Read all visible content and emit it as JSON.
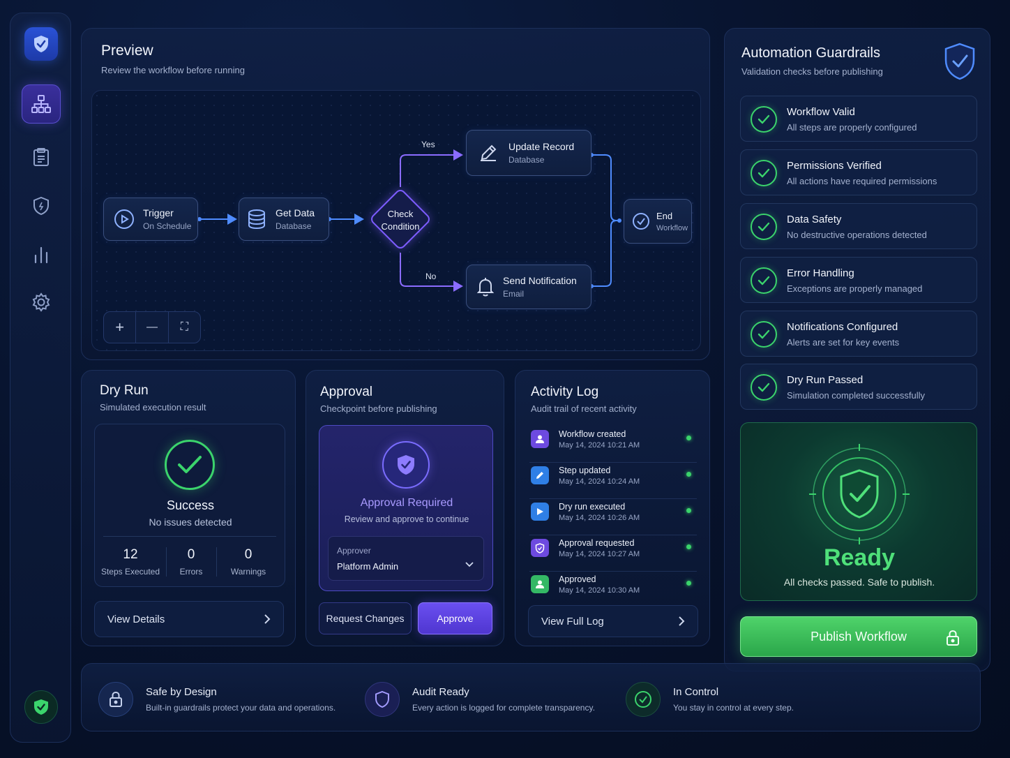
{
  "sidebar": {
    "items": [
      {
        "icon": "workflow-icon",
        "active": true
      },
      {
        "icon": "clipboard-icon",
        "active": false
      },
      {
        "icon": "shield-icon",
        "active": false
      },
      {
        "icon": "bar-chart-icon",
        "active": false
      },
      {
        "icon": "gear-icon",
        "active": false
      }
    ]
  },
  "preview": {
    "title": "Preview",
    "subtitle": "Review the workflow before running",
    "nodes": {
      "trigger": {
        "title": "Trigger",
        "sub": "On Schedule"
      },
      "get_data": {
        "title": "Get Data",
        "sub": "Database"
      },
      "check": {
        "line1": "Check",
        "line2": "Condition"
      },
      "update": {
        "title": "Update Record",
        "sub": "Database"
      },
      "notify": {
        "title": "Send Notification",
        "sub": "Email"
      },
      "end": {
        "title": "End",
        "sub": "Workflow"
      }
    },
    "yes_label": "Yes",
    "no_label": "No",
    "zoom": {
      "in": "+",
      "out": "—",
      "fit": "⛶"
    }
  },
  "dry_run": {
    "title": "Dry Run",
    "subtitle": "Simulated execution result",
    "status": "Success",
    "status_sub": "No issues detected",
    "stats": [
      {
        "value": "12",
        "label": "Steps Executed"
      },
      {
        "value": "0",
        "label": "Errors"
      },
      {
        "value": "0",
        "label": "Warnings"
      }
    ],
    "details_link": "View Details"
  },
  "approval": {
    "title": "Approval",
    "subtitle": "Checkpoint before publishing",
    "required": "Approval Required",
    "required_sub": "Review and approve to continue",
    "approver_label": "Approver",
    "approver_value": "Platform Admin",
    "request_changes": "Request Changes",
    "approve": "Approve"
  },
  "activity": {
    "title": "Activity Log",
    "subtitle": "Audit trail of recent activity",
    "entries": [
      {
        "title": "Workflow created",
        "date": "May 14, 2024 10:21 AM",
        "color": "#6d4ae0"
      },
      {
        "title": "Step updated",
        "date": "May 14, 2024 10:24 AM",
        "color": "#2f7fe6"
      },
      {
        "title": "Dry run executed",
        "date": "May 14, 2024 10:26 AM",
        "color": "#2f7fe6"
      },
      {
        "title": "Approval requested",
        "date": "May 14, 2024 10:27 AM",
        "color": "#6d4ae0"
      },
      {
        "title": "Approved",
        "date": "May 14, 2024 10:30 AM",
        "color": "#34b865"
      }
    ],
    "full_log": "View Full Log"
  },
  "guardrails": {
    "title": "Automation Guardrails",
    "subtitle": "Validation checks before publishing",
    "checks": [
      {
        "title": "Workflow Valid",
        "sub": "All steps are properly configured"
      },
      {
        "title": "Permissions Verified",
        "sub": "All actions have required permissions"
      },
      {
        "title": "Data Safety",
        "sub": "No destructive operations detected"
      },
      {
        "title": "Error Handling",
        "sub": "Exceptions are properly managed"
      },
      {
        "title": "Notifications Configured",
        "sub": "Alerts are set for key events"
      },
      {
        "title": "Dry Run Passed",
        "sub": "Simulation completed successfully"
      }
    ],
    "ready_title": "Ready",
    "ready_sub": "All checks passed. Safe to publish.",
    "publish": "Publish Workflow"
  },
  "footer": {
    "features": [
      {
        "title": "Safe by Design",
        "sub": "Built-in guardrails protect your data and operations."
      },
      {
        "title": "Audit Ready",
        "sub": "Every action is logged for complete transparency."
      },
      {
        "title": "In Control",
        "sub": "You stay in control at every step."
      }
    ]
  },
  "colors": {
    "accent_green": "#3bd46c",
    "accent_purple": "#6b5cff",
    "accent_blue": "#4f8cff"
  }
}
